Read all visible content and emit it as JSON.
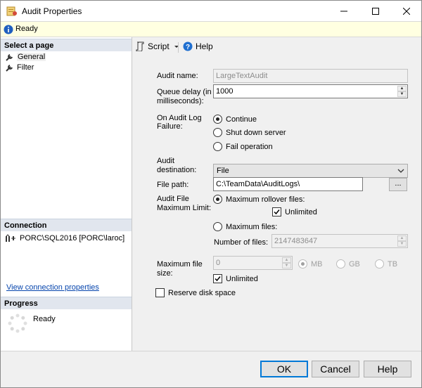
{
  "window": {
    "title": "Audit Properties"
  },
  "status": {
    "text": "Ready"
  },
  "left_pane": {
    "select_page_header": "Select a page",
    "pages": [
      {
        "label": "General",
        "selected": true
      },
      {
        "label": "Filter",
        "selected": false
      }
    ],
    "connection_header": "Connection",
    "connection_text": "PORC\\SQL2016 [PORC\\laroc]",
    "view_connection_link": "View connection properties",
    "progress_header": "Progress",
    "progress_text": "Ready"
  },
  "toolbar": {
    "script_label": "Script",
    "help_label": "Help"
  },
  "form": {
    "audit_name_label": "Audit name:",
    "audit_name_value": "LargeTextAudit",
    "queue_delay_label_1": "Queue delay (in",
    "queue_delay_label_2": "milliseconds):",
    "queue_delay_value": "1000",
    "on_failure_label_1": "On Audit Log",
    "on_failure_label_2": "Failure:",
    "on_failure_options": [
      "Continue",
      "Shut down server",
      "Fail operation"
    ],
    "on_failure_selected": "Continue",
    "destination_label_1": "Audit",
    "destination_label_2": "destination:",
    "destination_value": "File",
    "file_path_label": "File path:",
    "file_path_value": "C:\\TeamData\\AuditLogs\\",
    "browse_label": "...",
    "max_limit_label_1": "Audit File",
    "max_limit_label_2": "Maximum Limit:",
    "max_rollover_label": "Maximum rollover files:",
    "rollover_unlimited_label": "Unlimited",
    "max_files_label": "Maximum files:",
    "number_of_files_label": "Number of files:",
    "number_of_files_value": "2147483647",
    "max_file_size_label_1": "Maximum file",
    "max_file_size_label_2": "size:",
    "max_file_size_value": "0",
    "size_units": [
      "MB",
      "GB",
      "TB"
    ],
    "size_unlimited_label": "Unlimited",
    "reserve_disk_label": "Reserve disk space"
  },
  "buttons": {
    "ok": "OK",
    "cancel": "Cancel",
    "help": "Help"
  },
  "colors": {
    "status_bg": "#ffffe1",
    "section_header_bg": "#e1e6ee",
    "link": "#0645ad",
    "default_button_border": "#0078d7"
  }
}
